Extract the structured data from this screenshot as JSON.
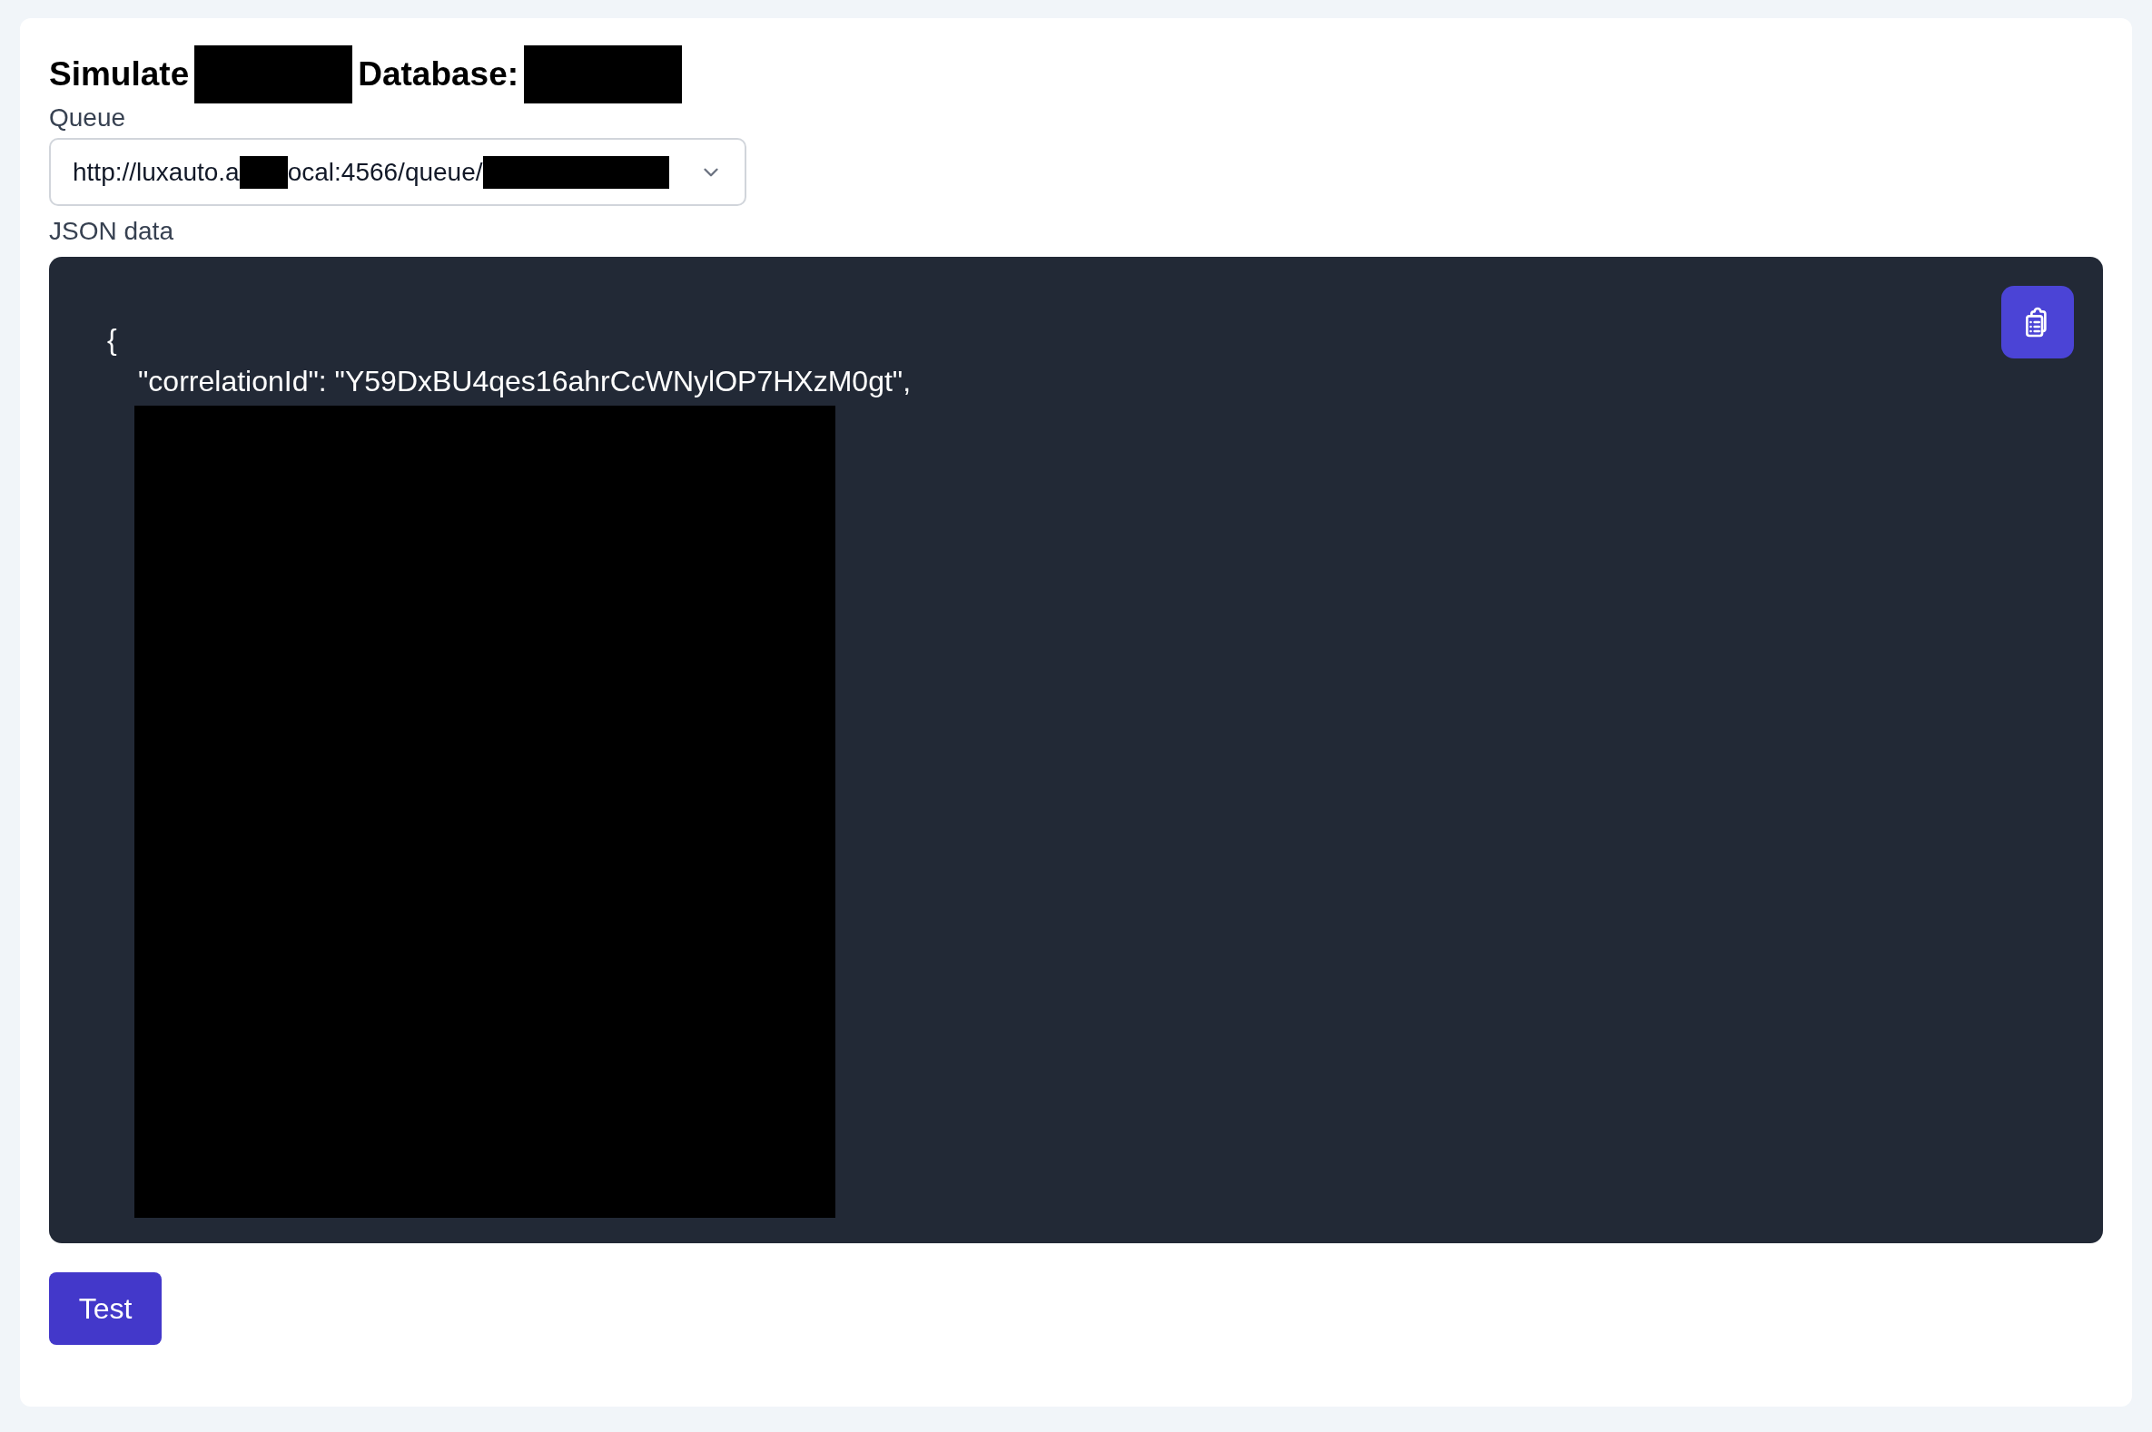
{
  "title": {
    "parts": [
      {
        "kind": "text",
        "text": "Simulate"
      },
      {
        "kind": "redacted"
      },
      {
        "kind": "text",
        "text": "Database:"
      },
      {
        "kind": "redacted"
      }
    ]
  },
  "queue": {
    "label": "Queue",
    "value": [
      {
        "kind": "text",
        "text": "http://luxauto.a"
      },
      {
        "kind": "redacted"
      },
      {
        "kind": "text",
        "text": "ocal:4566/queue/"
      },
      {
        "kind": "redacted"
      }
    ]
  },
  "json_data": {
    "label": "JSON data",
    "lines": [
      {
        "kind": "text",
        "text": "{",
        "children": [
          {
            "kind": "text",
            "text": "\"correlationId\": \"Y59DxBU4qes16ahrCcWNylOP7HXzM0gt\","
          },
          {
            "kind": "redacted"
          }
        ]
      }
    ]
  },
  "test_button": {
    "label": "Test"
  }
}
